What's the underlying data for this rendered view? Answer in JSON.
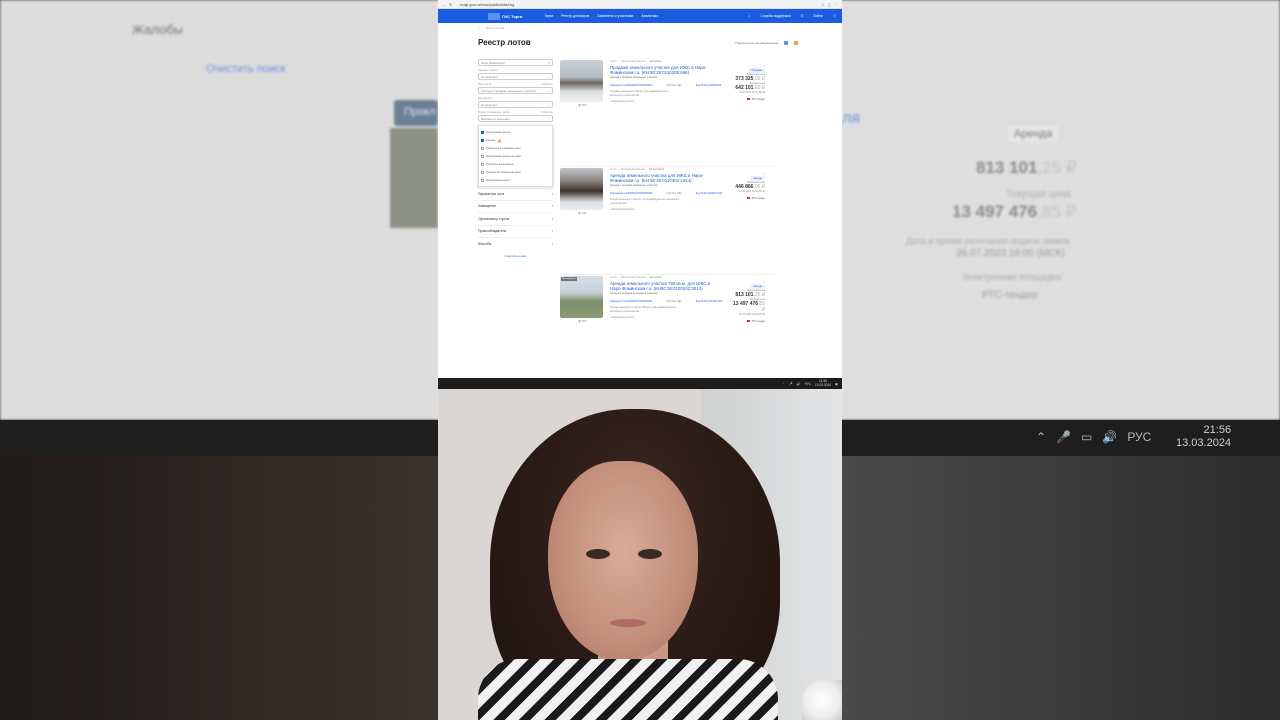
{
  "background": {
    "left_texts": [
      "Жалобы",
      "Очистить поиск",
      "Прокл"
    ],
    "right_texts": [
      "ля",
      "Аренда",
      "813 101",
      ",25 ₽",
      "Текущая цена",
      "13 497 476",
      ",85 ₽",
      "Дата и время окончания подачи заявок",
      "26.07.2023 18:00 (МСК)",
      "Электронная площадка",
      "РТС-тендер"
    ],
    "clock_time": "21:56",
    "clock_date": "13.03.2024",
    "tray_lang": "РУС"
  },
  "browser": {
    "url": "torgi.gov.ru/new/public/lots/reg"
  },
  "site": {
    "logo": "ГИС Торги",
    "nav": [
      "Торги",
      "Реестр договоров",
      "Заявители и участники",
      "Аналитика"
    ],
    "support": "Служба поддержки",
    "login": "Войти"
  },
  "page": {
    "breadcrumb": [
      "Главная",
      "Реестр лотов"
    ],
    "title": "Реестр лотов",
    "subscribe": "Подпишитесь на уведомления"
  },
  "filters": {
    "search_value": "Наро-Фоминский",
    "label1": "Предмет торгов",
    "select1": "Не выбрано",
    "label2": "Вид торгов",
    "reset": "Сбросить",
    "select2": "Аренда и продажа земельных участков",
    "label3": "Вид сделки",
    "select3": "Не выбрано",
    "label4": "Форма проведения торгов",
    "select4": "Выбрано 2 значения",
    "dropdown_items": [
      {
        "label": "Электронный аукцион",
        "checked": true
      },
      {
        "label": "Аукцион",
        "checked": true
      },
      {
        "label": "Повышение и понижение цены",
        "checked": false
      },
      {
        "label": "Электронный аукцион на право",
        "checked": false
      },
      {
        "label": "Публичное предложение",
        "checked": false
      },
      {
        "label": "Продажа без объявления цены",
        "checked": false
      },
      {
        "label": "Электронный конкурс",
        "checked": false
      }
    ],
    "accordions": [
      "Параметры лота",
      "Извещение",
      "Организатор торгов",
      "Правообладатель",
      "Жалобы"
    ],
    "clear": "Очистить поиск"
  },
  "lots": [
    {
      "meta": [
        "№ 1/1",
        "Электронный аукцион"
      ],
      "status": "Состоялся",
      "title": "Продажа земельного участка для ИЖС в Наро-Фоминском г.о. (КН 50:26:0110205:666)",
      "sub": "Аренда и продажа земельных участков",
      "col1": "Извещение №22000004470000000024",
      "col2": "НДС Без НДС",
      "col3": "Код 50.26.0110205.666",
      "desc": "Продажа земельного участка, для индивидуального жилищного строительства",
      "foot": "Московская область",
      "badge": "Продажа",
      "price_label": "Начальная цена",
      "price": "373 325",
      "price_kop": ",00 ₽",
      "current_label": "Текущая цена",
      "current": "642 101",
      "current_kop": ",60 ₽",
      "deadline": "14.06.2023 18:00 (МСК)",
      "platform": "РТС-тендер",
      "views": "166"
    },
    {
      "meta": [
        "№ 1/1",
        "Электронный аукцион"
      ],
      "status": "Не состоялся",
      "title": "Аренда земельного участка для ИЖС в Наро-Фоминском г.о. (КН 50:26:0110302:1314)",
      "sub": "Аренда и продажа земельных участков",
      "col1": "Извещение №22000004470000000026",
      "col2": "НДС Без НДС",
      "col3": "Код 50.26.0110302.1314",
      "desc": "Аренда земельного участка, для индивидуального жилищного строительства",
      "foot": "Московская область",
      "badge": "Аренда",
      "price_label": "Начальная цена",
      "price": "446 866",
      "price_kop": ",00 ₽",
      "current_label": "",
      "current": "",
      "current_kop": "",
      "deadline": "14.06.2023 18:00 (МСК)",
      "platform": "РТС-тендер",
      "views": "146"
    },
    {
      "meta": [
        "№ 1/1",
        "Электронный аукцион"
      ],
      "status": "Состоялся",
      "title": "Аренда земельного участка 750 кв.м. для ИЖС в Наро-Фоминском г.о. (КН50:26:0100102:3014)",
      "sub": "Аренда и продажа земельных участков",
      "col1": "Извещение №22000004470000000031",
      "col2": "НДС Без НДС",
      "col3": "Код 50.26.0100102.3014",
      "desc": "Аренда земельного участка 750 кв.м, для индивидуального жилищного строительства",
      "foot": "Московская область",
      "badge": "Аренда",
      "thumb_badge": "Просмотрено",
      "price_label": "Начальная цена",
      "price": "813 101",
      "price_kop": ",25 ₽",
      "current_label": "Текущая цена",
      "current": "13 497 476",
      "current_kop": ",85 ₽",
      "deadline": "26.07.2023 18:00 (МСК)",
      "platform": "РТС-тендер",
      "views": "163"
    }
  ],
  "taskbar": {
    "lang": "РУС",
    "time": "21:56",
    "date": "13.03.2024"
  }
}
